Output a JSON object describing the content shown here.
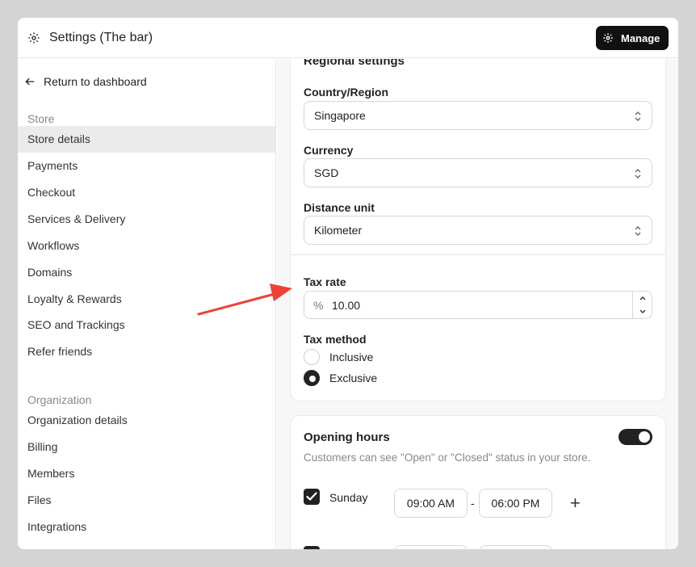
{
  "header": {
    "title": "Settings (The bar)",
    "manage_label": "Manage"
  },
  "sidebar": {
    "back_label": "Return to dashboard",
    "store_section": "Store",
    "store_items": [
      "Store details",
      "Payments",
      "Checkout",
      "Services & Delivery",
      "Workflows",
      "Domains",
      "Loyalty & Rewards",
      "SEO and Trackings",
      "Refer friends"
    ],
    "active_item": "Store details",
    "org_section": "Organization",
    "org_items": [
      "Organization details",
      "Billing",
      "Members",
      "Files",
      "Integrations"
    ]
  },
  "regional": {
    "heading": "Regional settings",
    "country_label": "Country/Region",
    "country_value": "Singapore",
    "currency_label": "Currency",
    "currency_value": "SGD",
    "distance_label": "Distance unit",
    "distance_value": "Kilometer",
    "tax_label": "Tax rate",
    "tax_symbol": "%",
    "tax_value": "10.00",
    "tax_method_label": "Tax method",
    "tax_methods": [
      "Inclusive",
      "Exclusive"
    ],
    "tax_method_selected": "Exclusive"
  },
  "hours": {
    "title": "Opening hours",
    "description": "Customers can see \"Open\" or \"Closed\" status in your store.",
    "enabled": true,
    "day": "Sunday",
    "open_time": "09:00 AM",
    "dash": "-",
    "close_time": "06:00 PM",
    "add_symbol": "+"
  },
  "annotation": {
    "arrow_color": "#ef4136"
  },
  "icons": {
    "settings": "gear-icon",
    "back": "arrow-left-icon",
    "select": "chevron-updown-icon"
  }
}
